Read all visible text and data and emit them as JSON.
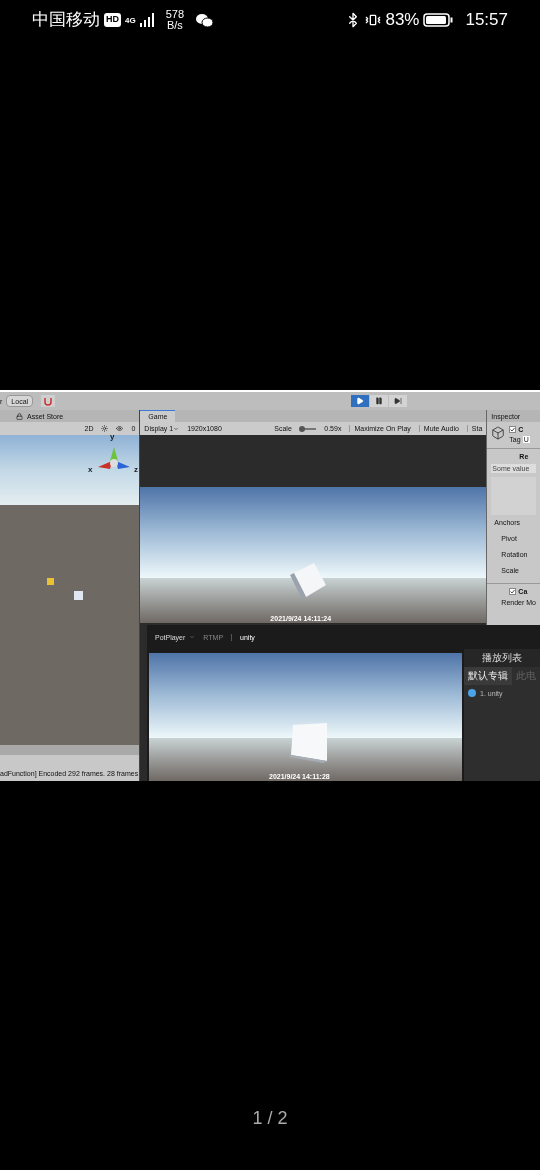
{
  "status_bar": {
    "carrier": "中国移动",
    "hd_badge": "HD",
    "network": "4G",
    "speed_value": "578",
    "speed_unit": "B/s",
    "battery": "83%",
    "time": "15:57"
  },
  "editor": {
    "toolbar": {
      "cut_label": "r",
      "local_button": "Local",
      "play_buttons": [
        {
          "kind": "play",
          "selected": true
        },
        {
          "kind": "pause",
          "selected": false
        },
        {
          "kind": "step",
          "selected": false
        }
      ]
    },
    "scene_panel": {
      "tab": "Asset Store",
      "mode_2d": "2D",
      "gizmo_count": "0",
      "axes": [
        "y",
        "x",
        "z"
      ]
    },
    "game_panel": {
      "tab": "Game",
      "display": "Display 1",
      "resolution": "1920x1080",
      "scale_label": "Scale",
      "scale": {
        "level": 0.15
      },
      "scale_value": "0.59x",
      "toggles": [
        "Maximize On Play",
        "Mute Audio",
        "Sta"
      ],
      "timestamp": "2021/9/24 14:11:24"
    },
    "inspector": {
      "tab": "Inspector",
      "object_checked": true,
      "object_name": "C",
      "tag_label": "Tag",
      "tag_value": "U",
      "rect_section": "Re",
      "rect_hint": "Some value",
      "rect_fields": [
        "Anchors",
        "Pivot",
        "Rotation",
        "Scale"
      ],
      "canvas_section": "Ca",
      "canvas_checked": true,
      "canvas_fields": [
        "Render Mo"
      ]
    },
    "console": "adFunction] Encoded 292 frames. 28 frames"
  },
  "potplayer": {
    "app": "PotPlayer",
    "protocol": "RTMP",
    "stream": "unity",
    "timestamp": "2021/9/24 14:11:28",
    "playlist": {
      "title": "播放列表",
      "tabs": [
        {
          "label": "默认专辑",
          "selected": true
        },
        {
          "label": "此电",
          "selected": false
        }
      ],
      "items": [
        {
          "label": "1. unity"
        }
      ]
    }
  },
  "pager": "1 / 2"
}
